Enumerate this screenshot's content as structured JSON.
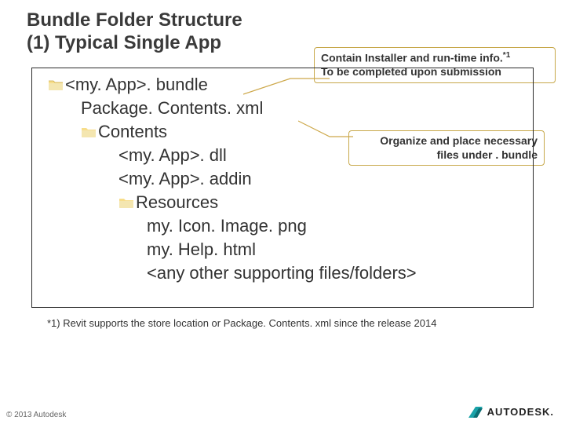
{
  "title_line1": "Bundle Folder Structure",
  "title_line2": "(1) Typical Single App",
  "callout1_line1": "Contain Installer and run-time info.",
  "callout1_sup": "*1",
  "callout1_line2": "To be completed upon submission",
  "callout2_line1": "Organize and place necessary",
  "callout2_line2": "files under . bundle",
  "tree": {
    "r1": "<my. App>. bundle",
    "r2": "Package. Contents. xml",
    "r3": "Contents",
    "r4": "<my. App>. dll",
    "r5": "<my. App>. addin",
    "r6": "Resources",
    "r7": "my. Icon. Image. png",
    "r8": "my. Help. html",
    "r9": "<any other supporting files/folders>"
  },
  "footnote": "*1) Revit supports the store location or Package. Contents. xml since the release 2014",
  "copyright": "© 2013 Autodesk",
  "logo_text": "AUTODESK."
}
